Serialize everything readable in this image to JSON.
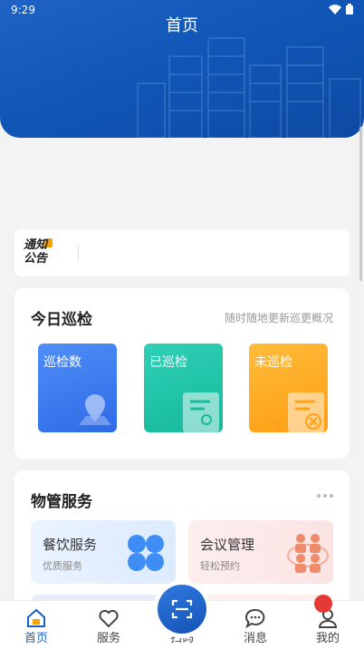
{
  "status_bar": {
    "time": "9:29"
  },
  "header": {
    "title": "首页"
  },
  "notice": {
    "logo_line1": "通知",
    "logo_line2": "公告"
  },
  "patrol": {
    "title": "今日巡检",
    "subtitle": "随时随地更新巡更概况",
    "tiles": [
      {
        "label": "巡检数",
        "icon": "map-pin-icon"
      },
      {
        "label": "已巡检",
        "icon": "document-search-icon"
      },
      {
        "label": "未巡检",
        "icon": "document-cancel-icon"
      }
    ]
  },
  "services": {
    "title": "物管服务",
    "items": [
      {
        "name": "餐饮服务",
        "desc": "优质服务",
        "icon": "clover-icon"
      },
      {
        "name": "会议管理",
        "desc": "轻松预约",
        "icon": "meeting-people-icon"
      }
    ]
  },
  "tabbar": {
    "items": [
      {
        "label": "首页",
        "icon": "home-icon",
        "active": true
      },
      {
        "label": "服务",
        "icon": "heart-icon"
      },
      {
        "label": "扫码",
        "icon": "scan-icon"
      },
      {
        "label": "消息",
        "icon": "chat-icon"
      },
      {
        "label": "我的",
        "icon": "user-icon"
      }
    ]
  },
  "colors": {
    "primary": "#1b5ec7",
    "tile_blue": "#3d7cf0",
    "tile_green": "#1fc4a6",
    "tile_orange": "#ffaa22"
  }
}
